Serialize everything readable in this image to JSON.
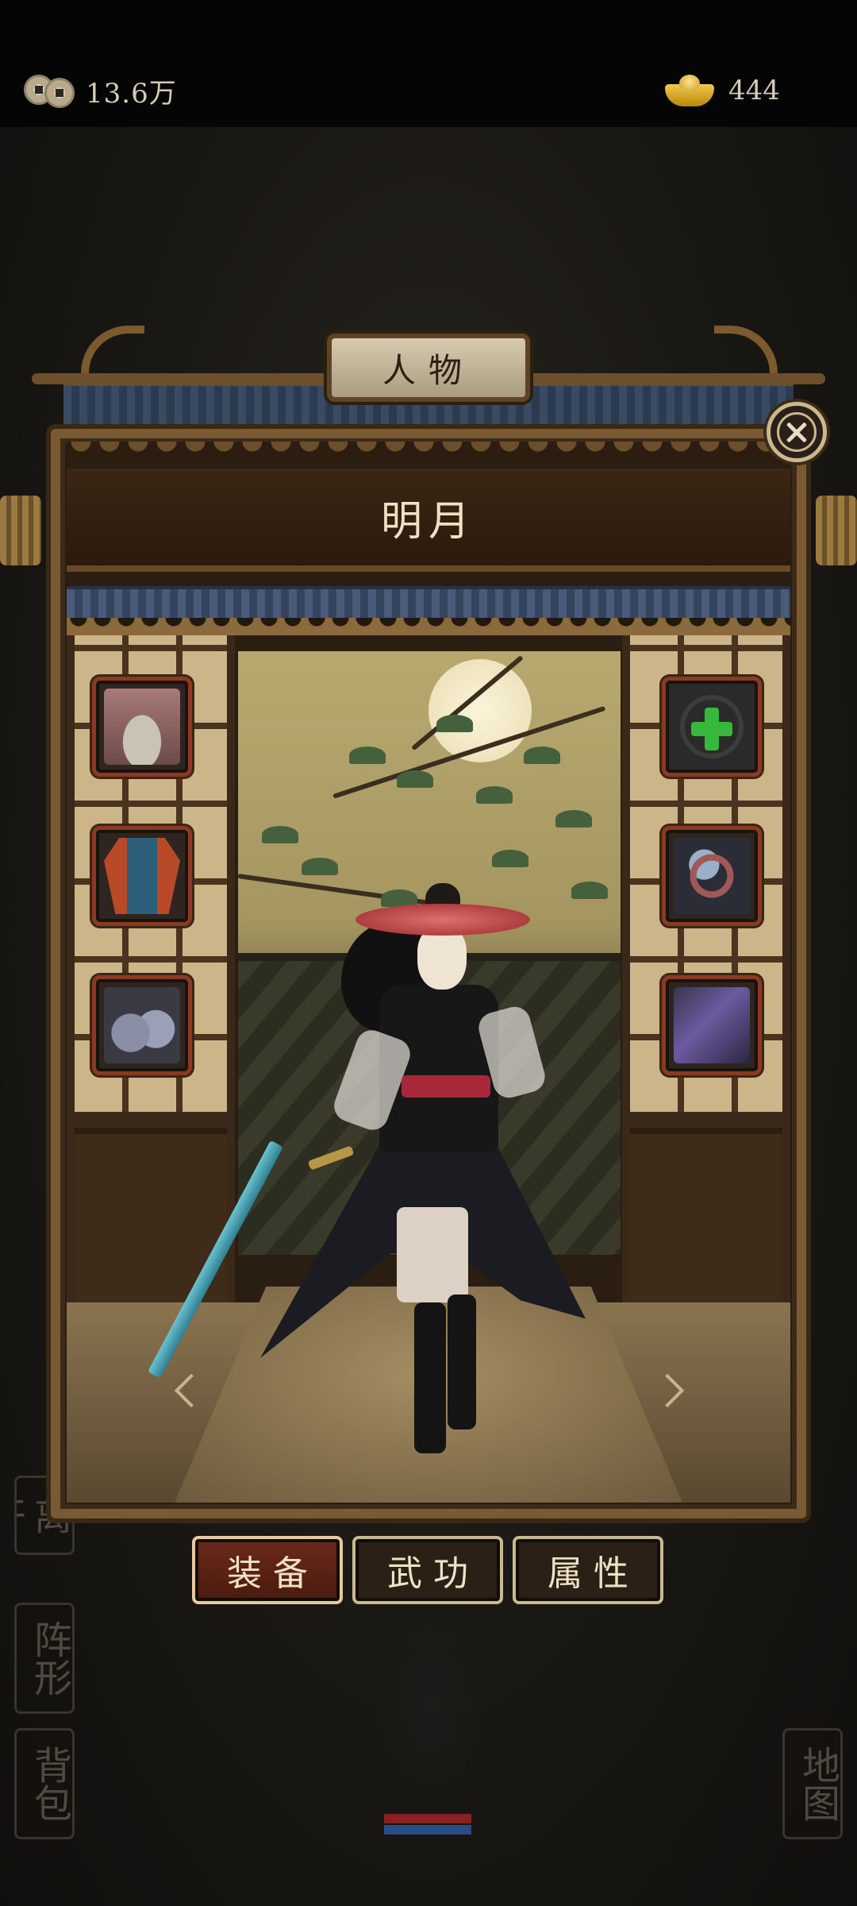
{
  "currency": {
    "coins": "13.6万",
    "gold": "444"
  },
  "panel": {
    "title": "人物",
    "character_name": "明月"
  },
  "equipment": {
    "left_slots": [
      "hat",
      "armor",
      "boots"
    ],
    "right_slots": [
      "add",
      "ring",
      "robe"
    ]
  },
  "tabs": [
    {
      "label": "装备",
      "active": true
    },
    {
      "label": "武功",
      "active": false
    },
    {
      "label": "属性",
      "active": false
    }
  ],
  "side_menu": {
    "partial_label": "离开",
    "formation": "阵形",
    "bag": "背包",
    "map": "地图"
  },
  "colors": {
    "accent": "#cbb88e",
    "active_tab": "#6b2a1a",
    "plus": "#37b83a"
  }
}
